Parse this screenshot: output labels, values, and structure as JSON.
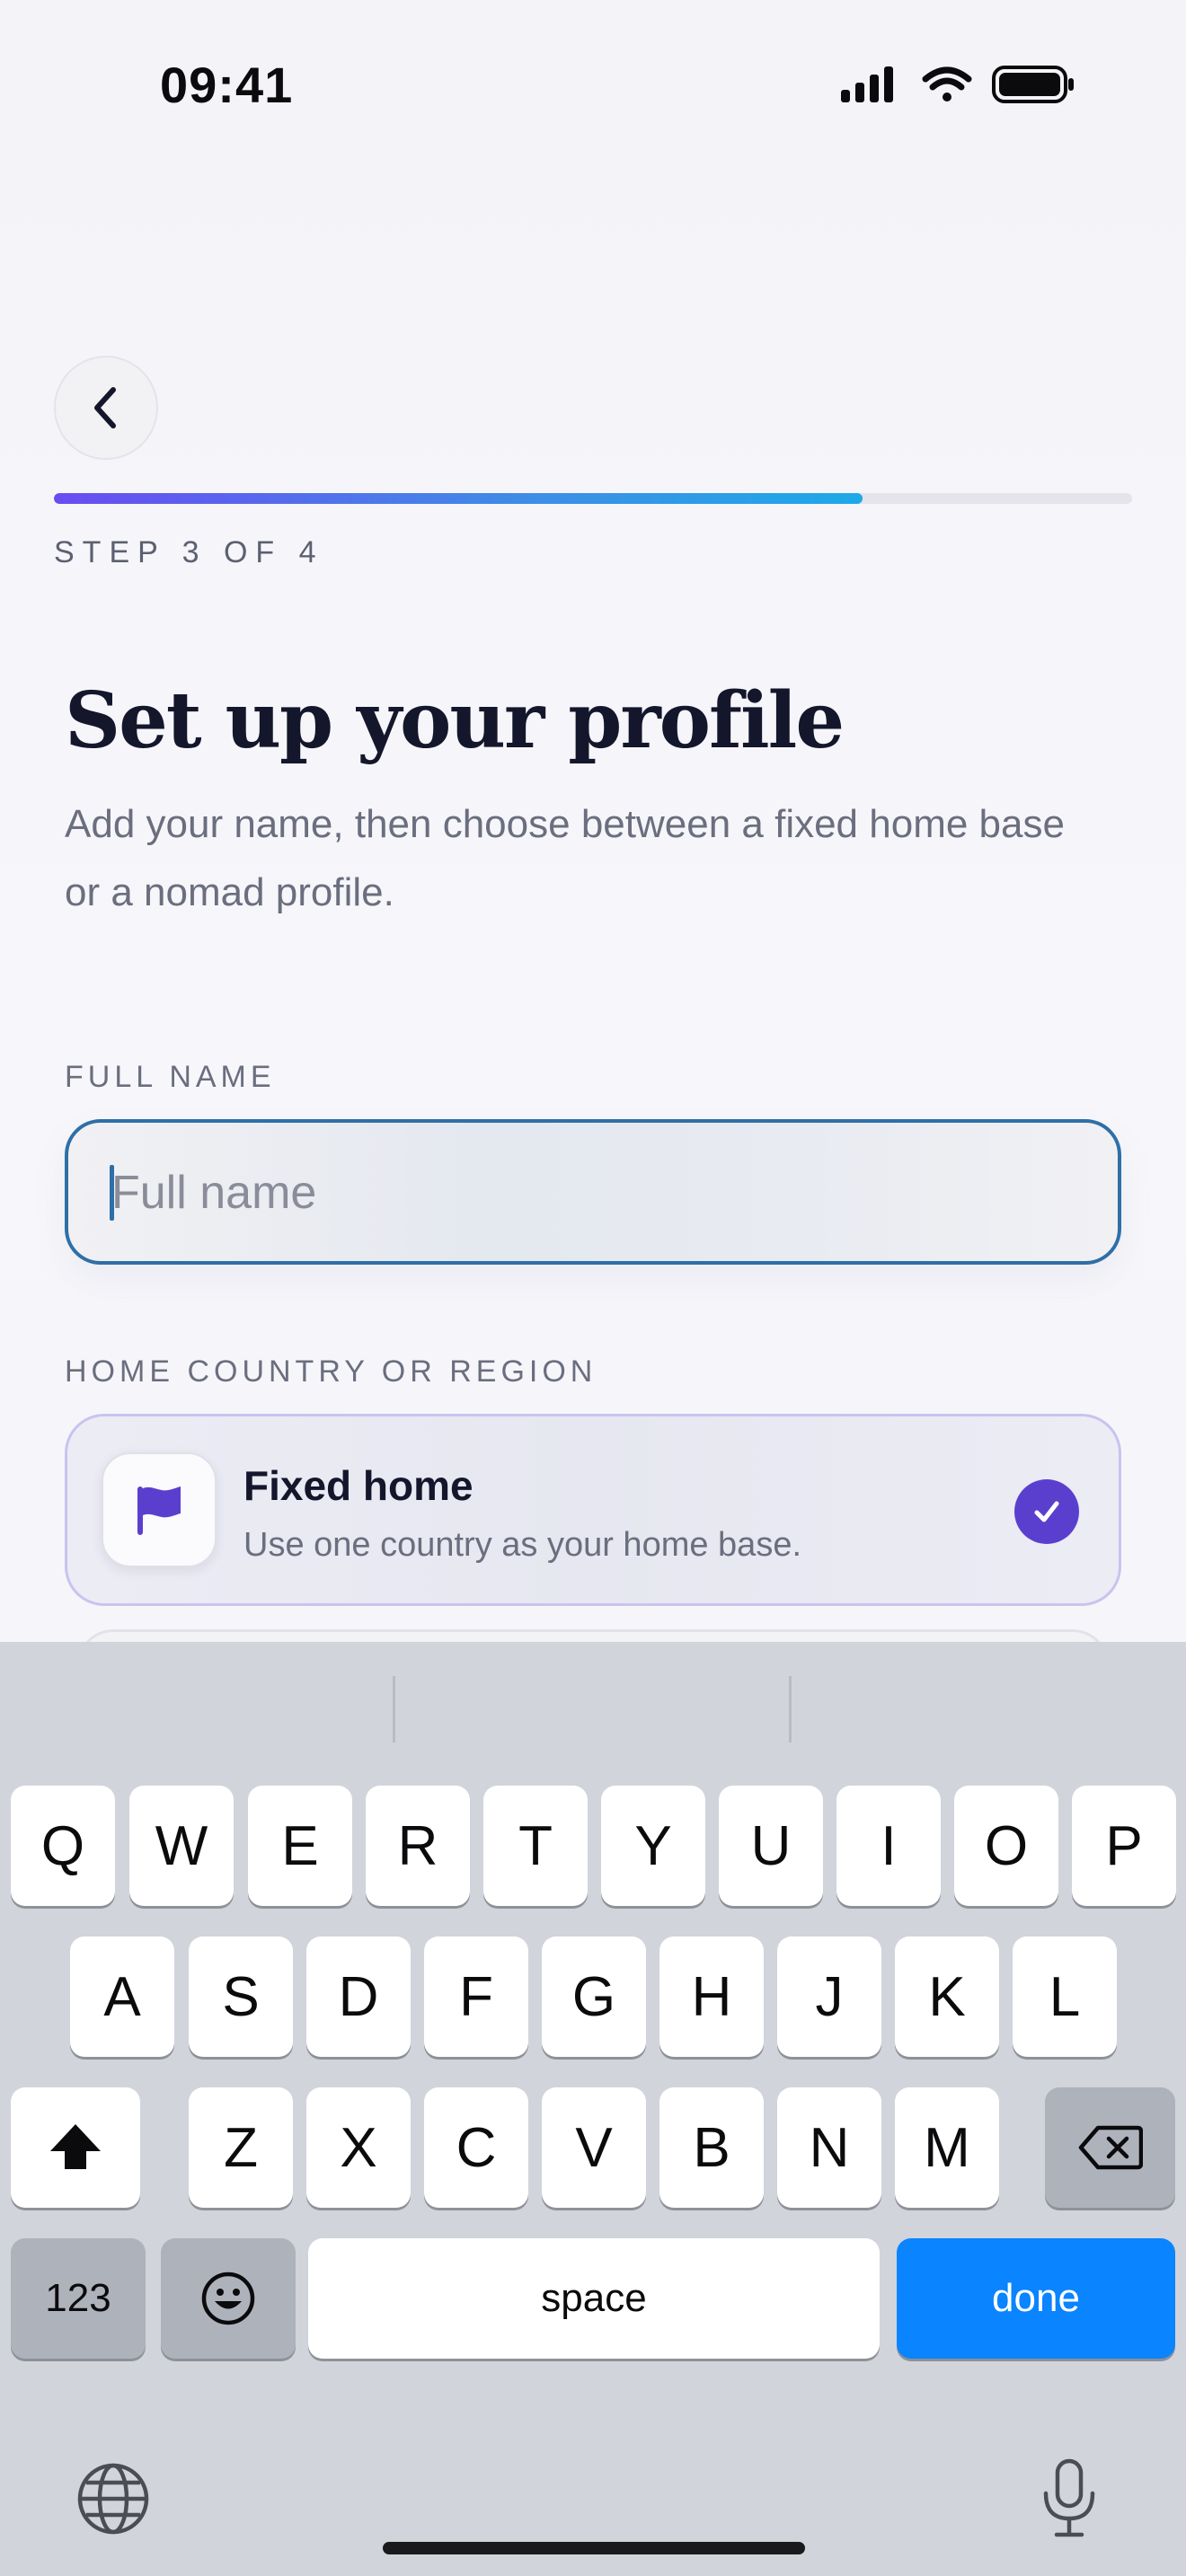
{
  "status_bar": {
    "time": "09:41"
  },
  "progress": {
    "step_label": "STEP 3 OF 4",
    "fraction": 0.75
  },
  "header": {
    "title": "Set up your profile",
    "subtitle": "Add your name, then choose between a fixed home base or a nomad profile."
  },
  "full_name": {
    "label": "FULL NAME",
    "placeholder": "Full name",
    "value": ""
  },
  "home_region": {
    "label": "HOME COUNTRY OR REGION",
    "options": [
      {
        "title": "Fixed home",
        "description": "Use one country as your home base.",
        "icon": "flag-icon",
        "selected": true
      }
    ]
  },
  "keyboard": {
    "row1": [
      "Q",
      "W",
      "E",
      "R",
      "T",
      "Y",
      "U",
      "I",
      "O",
      "P"
    ],
    "row2": [
      "A",
      "S",
      "D",
      "F",
      "G",
      "H",
      "J",
      "K",
      "L"
    ],
    "row3": [
      "Z",
      "X",
      "C",
      "V",
      "B",
      "N",
      "M"
    ],
    "numbers_label": "123",
    "space_label": "space",
    "done_label": "done"
  },
  "colors": {
    "accent": "#5a3fcf",
    "input_border": "#2e6fa7",
    "done_key": "#0a84ff"
  }
}
